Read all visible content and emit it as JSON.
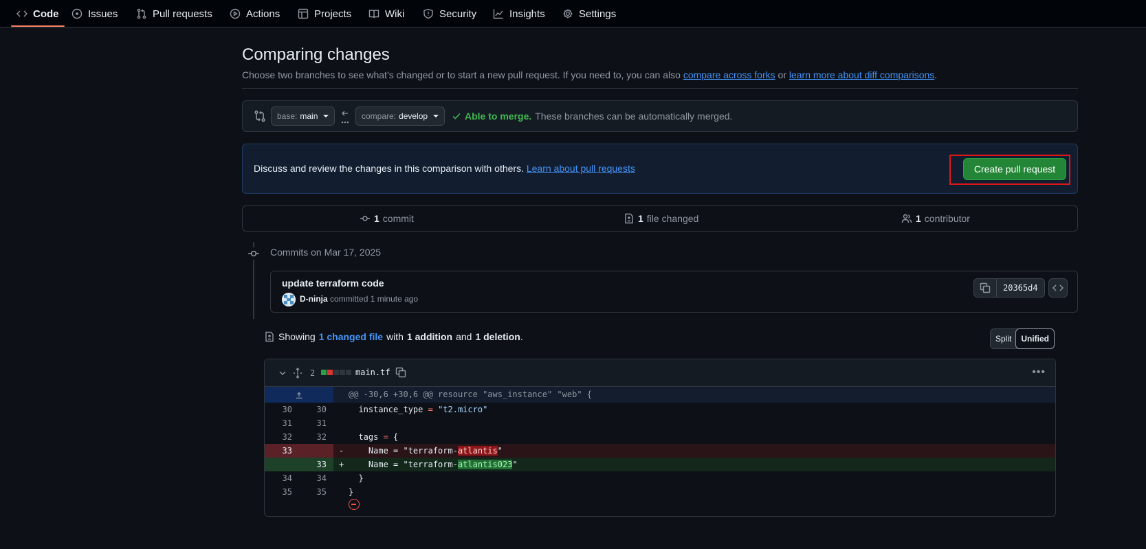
{
  "nav": {
    "tabs": [
      {
        "label": "Code",
        "icon": "code-icon",
        "active": true
      },
      {
        "label": "Issues",
        "icon": "issue-opened-icon"
      },
      {
        "label": "Pull requests",
        "icon": "git-pull-request-icon"
      },
      {
        "label": "Actions",
        "icon": "play-icon"
      },
      {
        "label": "Projects",
        "icon": "table-icon"
      },
      {
        "label": "Wiki",
        "icon": "book-icon"
      },
      {
        "label": "Security",
        "icon": "shield-icon"
      },
      {
        "label": "Insights",
        "icon": "graph-icon"
      },
      {
        "label": "Settings",
        "icon": "gear-icon"
      }
    ]
  },
  "page": {
    "title": "Comparing changes",
    "subtitle_prefix": "Choose two branches to see what’s changed or to start a new pull request. If you need to, you can also",
    "subtitle_link1": "compare across forks",
    "subtitle_or": "or",
    "subtitle_link2": "learn more about diff comparisons",
    "subtitle_end": "."
  },
  "range": {
    "base_label": "base:",
    "base_value": "main",
    "compare_label": "compare:",
    "compare_value": "develop",
    "merge_status": "Able to merge.",
    "merge_detail": "These branches can be automatically merged."
  },
  "discuss": {
    "text": "Discuss and review the changes in this comparison with others.",
    "link": "Learn about pull requests",
    "create_button": "Create pull request"
  },
  "stats": {
    "commits_count": "1",
    "commits_label": "commit",
    "files_count": "1",
    "files_label": "file changed",
    "contributors_count": "1",
    "contributors_label": "contributor"
  },
  "commits": {
    "date_heading": "Commits on Mar 17, 2025",
    "items": [
      {
        "title": "update terraform code",
        "author": "D-ninja",
        "action": "committed",
        "time": "1 minute ago",
        "sha": "20365d4"
      }
    ]
  },
  "summary": {
    "prefix": "Showing",
    "files_link": "1 changed file",
    "with": "with",
    "additions": "1 addition",
    "and": "and",
    "deletions": "1 deletion",
    "end": "."
  },
  "view_toggle": {
    "split": "Split",
    "unified": "Unified",
    "selected": "Unified"
  },
  "diff": {
    "changes_count": "2",
    "filename": "main.tf",
    "hunk_header": "@@ -30,6 +30,6 @@ resource \"aws_instance\" \"web\" {",
    "lines": [
      {
        "type": "ctx",
        "old": "30",
        "new": "30",
        "code": "  instance_type = \"t2.micro\""
      },
      {
        "type": "ctx",
        "old": "31",
        "new": "31",
        "code": ""
      },
      {
        "type": "ctx",
        "old": "32",
        "new": "32",
        "code": "  tags = {"
      },
      {
        "type": "del",
        "old": "33",
        "new": "",
        "sign": "-",
        "code_before": "    Name = \"terraform-",
        "code_hl": "atlantis",
        "code_after": "\""
      },
      {
        "type": "add",
        "old": "",
        "new": "33",
        "sign": "+",
        "code_before": "    Name = \"terraform-",
        "code_hl": "atlantis023",
        "code_after": "\""
      },
      {
        "type": "ctx",
        "old": "34",
        "new": "34",
        "code": "  }"
      },
      {
        "type": "ctx",
        "old": "35",
        "new": "35",
        "code": "}"
      }
    ]
  },
  "colors": {
    "accent": "#f78166",
    "merge_ok": "#3fb950",
    "create_button": "#238636",
    "link": "#4493f8",
    "highlight_outline": "#e01818"
  }
}
